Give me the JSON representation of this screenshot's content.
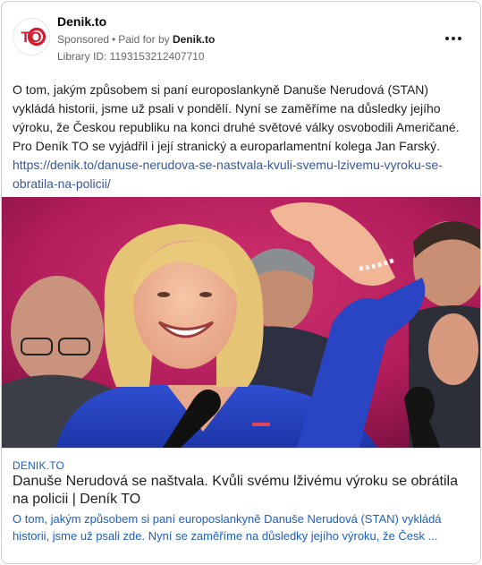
{
  "ad": {
    "page_name": "Denik.to",
    "sponsored_label": "Sponsored",
    "separator": "•",
    "paid_for_by_label": "Paid for by",
    "paid_for_by_name": "Denik.to",
    "library_id": "Library ID: 1193153212407710",
    "avatar_text": "TO",
    "brand_color": "#d7192d",
    "more_icon": "more-horizontal-icon",
    "body_text": "O tom, jakým způsobem si paní europoslankyně Danuše Nerudová (STAN) vykládá historii, jsme už psali v pondělí. Nyní se zaměříme na důsledky jejího výroku, že Českou republiku na konci druhé světové války osvobodili Američané. Pro Deník TO se vyjádřil i její stranický a europarlamentní kolega Jan Farský.",
    "body_link": "https://denik.to/danuse-nerudova-se-nastvala-kvuli-svemu-lzivemu-vyroku-se-obratila-na-policii/"
  },
  "preview": {
    "domain": "DENIK.TO",
    "title": "Danuše Nerudová se naštvala. Kvůli svému lživému výroku se obrátila na policii | Deník TO",
    "description": "O tom, jakým způsobem si paní europoslankyně Danuše Nerudová (STAN) vykládá historii, jsme už psali zde. Nyní se zaměříme na důsledky jejího výroku, že Česk ...",
    "link_color": "#1f5fbf"
  }
}
